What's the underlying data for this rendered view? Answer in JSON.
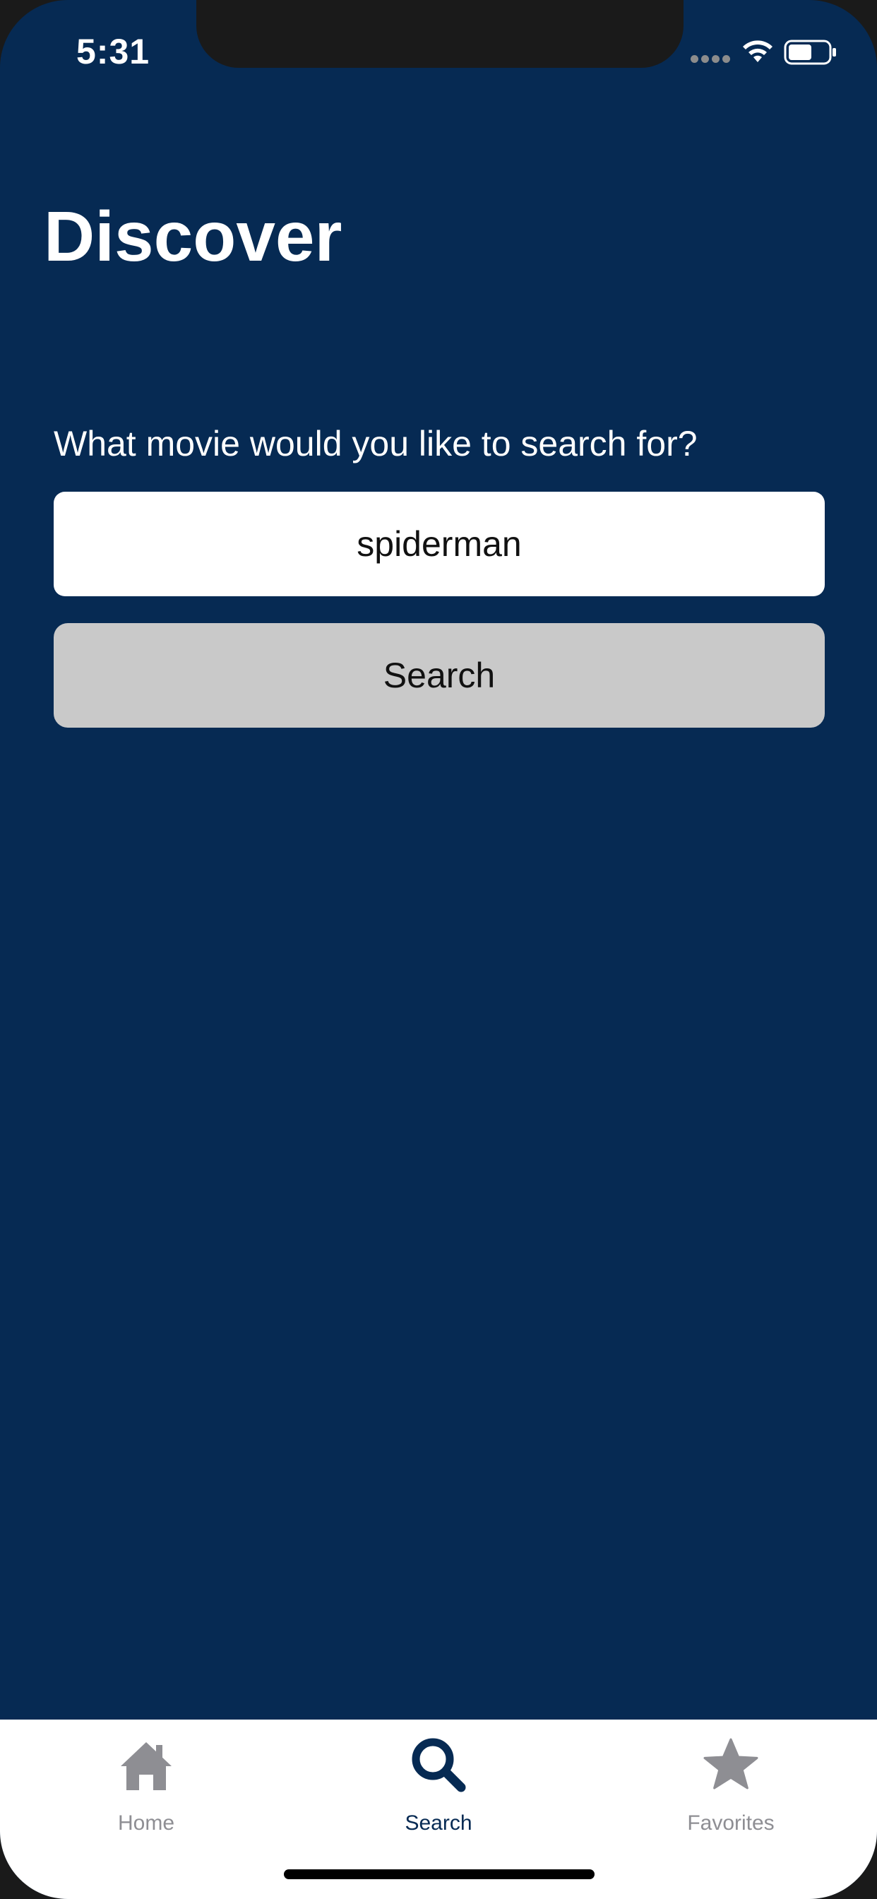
{
  "status_bar": {
    "time": "5:31",
    "icons": [
      "signal-dots-icon",
      "wifi-icon",
      "battery-icon"
    ]
  },
  "header": {
    "title": "Discover"
  },
  "search": {
    "prompt": "What movie would you like to search for?",
    "value": "spiderman",
    "button_label": "Search"
  },
  "tab_bar": {
    "tabs": [
      {
        "label": "Home",
        "icon": "house-icon",
        "selected": false
      },
      {
        "label": "Search",
        "icon": "magnifier-icon",
        "selected": true
      },
      {
        "label": "Favorites",
        "icon": "star-icon",
        "selected": false
      }
    ]
  },
  "colors": {
    "background": "#062a53",
    "accent": "#062a53",
    "button": "#c9c9c9",
    "tab_inactive": "#8e8e93",
    "tab_bar": "#ffffff"
  }
}
